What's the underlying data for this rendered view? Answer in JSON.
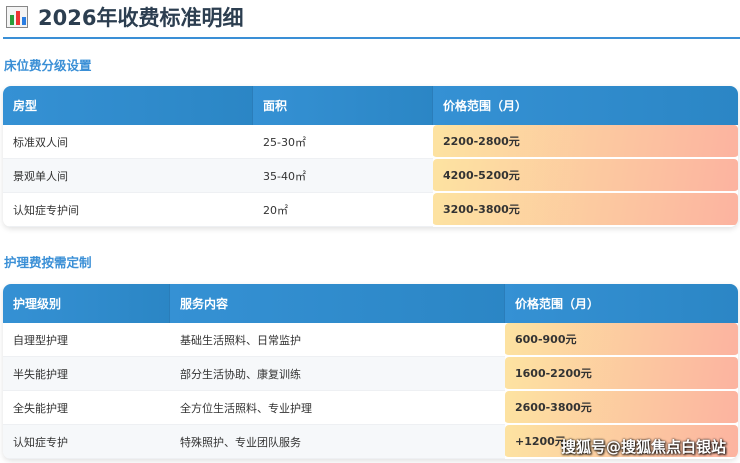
{
  "title": "2026年收费标准明细",
  "bed": {
    "heading": "床位费分级设置",
    "headers": [
      "房型",
      "面积",
      "价格范围（月）"
    ],
    "rows": [
      [
        "标准双人间",
        "25-30㎡",
        "2200-2800元"
      ],
      [
        "景观单人间",
        "35-40㎡",
        "4200-5200元"
      ],
      [
        "认知症专护间",
        "20㎡",
        "3200-3800元"
      ]
    ]
  },
  "care": {
    "heading": "护理费按需定制",
    "headers": [
      "护理级别",
      "服务内容",
      "价格范围（月）"
    ],
    "rows": [
      [
        "自理型护理",
        "基础生活照料、日常监护",
        "600-900元"
      ],
      [
        "半失能护理",
        "部分生活协助、康复训练",
        "1600-2200元"
      ],
      [
        "全失能护理",
        "全方位生活照料、专业护理",
        "2600-3800元"
      ],
      [
        "认知症专护",
        "特殊照护、专业团队服务",
        "+1200元"
      ]
    ]
  },
  "watermark": "搜狐号@搜狐焦点白银站"
}
